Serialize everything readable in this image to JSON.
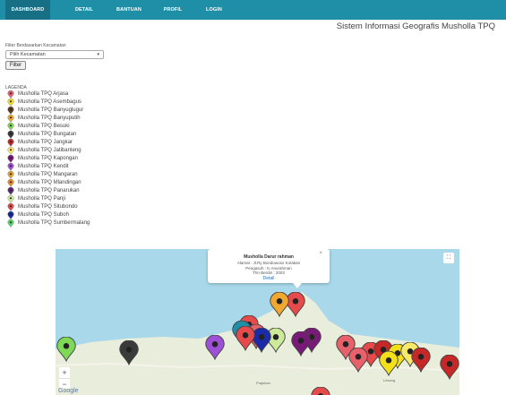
{
  "nav": {
    "items": [
      {
        "label": "DASHBOARD",
        "active": true
      },
      {
        "label": "DETAIL",
        "active": false
      },
      {
        "label": "BANTUAN",
        "active": false
      },
      {
        "label": "PROFIL",
        "active": false
      },
      {
        "label": "LOGIN",
        "active": false
      }
    ]
  },
  "header": {
    "title": "Sistem Informasi Geografis Musholla TPQ"
  },
  "filter": {
    "label": "Filter Berdasarkan Kecamatan",
    "select_value": "Pilih Kecamatan",
    "button_label": "Filter"
  },
  "legend": {
    "title": "LAGENDA",
    "items": [
      {
        "label": "Musholla TPQ Arjasa",
        "color": "#e8606a"
      },
      {
        "label": "Musholla TPQ Asembagus",
        "color": "#f4e01a"
      },
      {
        "label": "Musholla TPQ Banyuglugur",
        "color": "#5a3a22"
      },
      {
        "label": "Musholla TPQ Banyuputih",
        "color": "#f0a830"
      },
      {
        "label": "Musholla TPQ Besuki",
        "color": "#7ed957"
      },
      {
        "label": "Musholla TPQ Bungatan",
        "color": "#3a3a3a"
      },
      {
        "label": "Musholla TPQ Jangkar",
        "color": "#c62828"
      },
      {
        "label": "Musholla TPQ Jatibanteng",
        "color": "#f7ea6a"
      },
      {
        "label": "Musholla TPQ Kapongan",
        "color": "#7a1a78"
      },
      {
        "label": "Musholla TPQ Kendit",
        "color": "#9d4fd6"
      },
      {
        "label": "Musholla TPQ Mangaran",
        "color": "#e6a12a"
      },
      {
        "label": "Musholla TPQ Mlandingan",
        "color": "#f08a22"
      },
      {
        "label": "Musholla TPQ Panarukan",
        "color": "#5a2a7a"
      },
      {
        "label": "Musholla TPQ Panji",
        "color": "#cdea9a"
      },
      {
        "label": "Musholla TPQ Situbondo",
        "color": "#e64a4a"
      },
      {
        "label": "Musholla TPQ Suboh",
        "color": "#1a2aa8"
      },
      {
        "label": "Musholla TPQ Sumbermalang",
        "color": "#5ad66a"
      }
    ]
  },
  "map": {
    "fullscreen_icon": "fullscreen-icon",
    "zoom_in": "+",
    "zoom_out": "−",
    "google_label": "Google",
    "place_labels": [
      "Prajekan",
      "Lesong"
    ],
    "popup": {
      "title": "Musholla Darur rahman",
      "line1": "Alamat : Jl.Ry Bondowoso Kotakan",
      "line2": "Pengasuh : K.Anurahman",
      "line3": "Thn Berdiri : 2003",
      "link": "Detail",
      "close": "×"
    }
  }
}
